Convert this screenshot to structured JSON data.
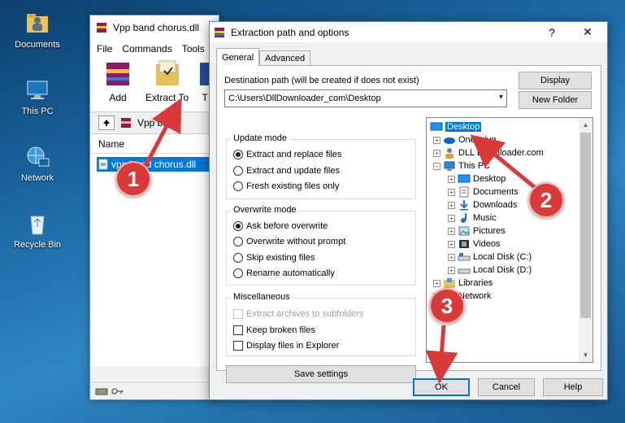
{
  "desktop": {
    "icons": [
      {
        "label": "Documents"
      },
      {
        "label": "This PC"
      },
      {
        "label": "Network"
      },
      {
        "label": "Recycle Bin"
      }
    ]
  },
  "winrar": {
    "title": "Vpp band chorus.dll",
    "menu": [
      "File",
      "Commands",
      "Tools"
    ],
    "toolbar": {
      "add": "Add",
      "extract_to": "Extract To",
      "t": "T"
    },
    "path_text": "Vpp band",
    "list_header": "Name",
    "file_name": "vpp band chorus.dll"
  },
  "dialog": {
    "title": "Extraction path and options",
    "help": "?",
    "close": "✕",
    "tabs": [
      "General",
      "Advanced"
    ],
    "dest_label": "Destination path (will be created if does not exist)",
    "dest_value": "C:\\Users\\DllDownloader_com\\Desktop",
    "buttons": {
      "display": "Display",
      "new_folder": "New Folder",
      "save_settings": "Save settings",
      "ok": "OK",
      "cancel": "Cancel",
      "help": "Help"
    },
    "update_mode": {
      "title": "Update mode",
      "options": [
        "Extract and replace files",
        "Extract and update files",
        "Fresh existing files only"
      ],
      "selected": 0
    },
    "overwrite_mode": {
      "title": "Overwrite mode",
      "options": [
        "Ask before overwrite",
        "Overwrite without prompt",
        "Skip existing files",
        "Rename automatically"
      ],
      "selected": 0
    },
    "misc": {
      "title": "Miscellaneous",
      "options": [
        "Extract archives to subfolders",
        "Keep broken files",
        "Display files in Explorer"
      ]
    },
    "tree": [
      {
        "label": "Desktop",
        "selected": true
      },
      {
        "label": "OneDrive"
      },
      {
        "label": "DLL Downloader.com"
      },
      {
        "label": "This PC"
      },
      {
        "label": "Desktop"
      },
      {
        "label": "Documents"
      },
      {
        "label": "Downloads"
      },
      {
        "label": "Music"
      },
      {
        "label": "Pictures"
      },
      {
        "label": "Videos"
      },
      {
        "label": "Local Disk (C:)"
      },
      {
        "label": "Local Disk (D:)"
      },
      {
        "label": "Libraries"
      },
      {
        "label": "Network"
      }
    ]
  },
  "callouts": [
    "1",
    "2",
    "3"
  ],
  "colors": {
    "accent": "#0078d7",
    "callout": "#d83a3a"
  }
}
